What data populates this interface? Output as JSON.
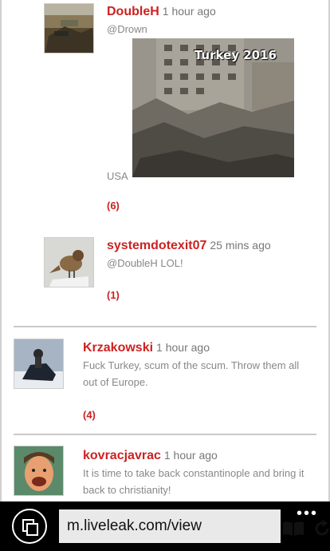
{
  "comments": [
    {
      "user": "DoubleH",
      "time": "1 hour ago",
      "text": "@Drown",
      "location": "USA",
      "image_caption": "Turkey 2016",
      "replies": "(6)"
    },
    {
      "user": "systemdotexit07",
      "time": "25 mins ago",
      "text": "@DoubleH LOL!",
      "replies": "(1)"
    },
    {
      "user": "Krzakowski",
      "time": "1 hour ago",
      "text": "Fuck Turkey, scum of the scum. Throw them all out of Europe.",
      "replies": "(4)"
    },
    {
      "user": "kovracjavrac",
      "time": "1 hour ago",
      "text": "It is time to take back constantinople and bring it back to christianity!"
    }
  ],
  "browser": {
    "url": "m.liveleak.com/view",
    "tabs_icon": "tabs-icon",
    "reading_icon": "reading-view-icon",
    "refresh_icon": "refresh-icon",
    "more_icon": "more-dots-icon"
  }
}
